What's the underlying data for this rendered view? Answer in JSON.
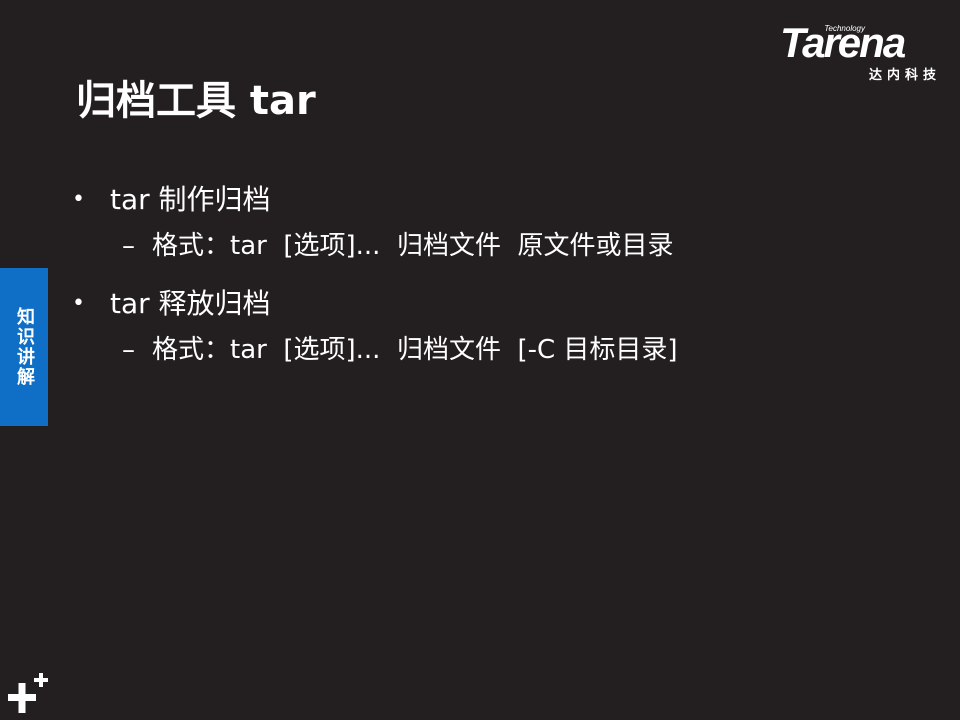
{
  "logo": {
    "tagline": "Technology",
    "wordmark": "Tarena",
    "chinese_name": "达内科技"
  },
  "slide": {
    "title": "归档工具 tar",
    "bullets": [
      {
        "text": "tar 制作归档",
        "sub": "格式：tar  [选项]...  归档文件  原文件或目录"
      },
      {
        "text": "tar 释放归档",
        "sub": "格式：tar  [选项]...  归档文件  [-C 目标目录]"
      }
    ]
  },
  "side_tab": {
    "label": "知识讲解",
    "color": "#0f6fc6"
  },
  "colors": {
    "background": "#231f20",
    "text": "#ffffff"
  },
  "icons": {
    "corner": "plus-icon"
  }
}
